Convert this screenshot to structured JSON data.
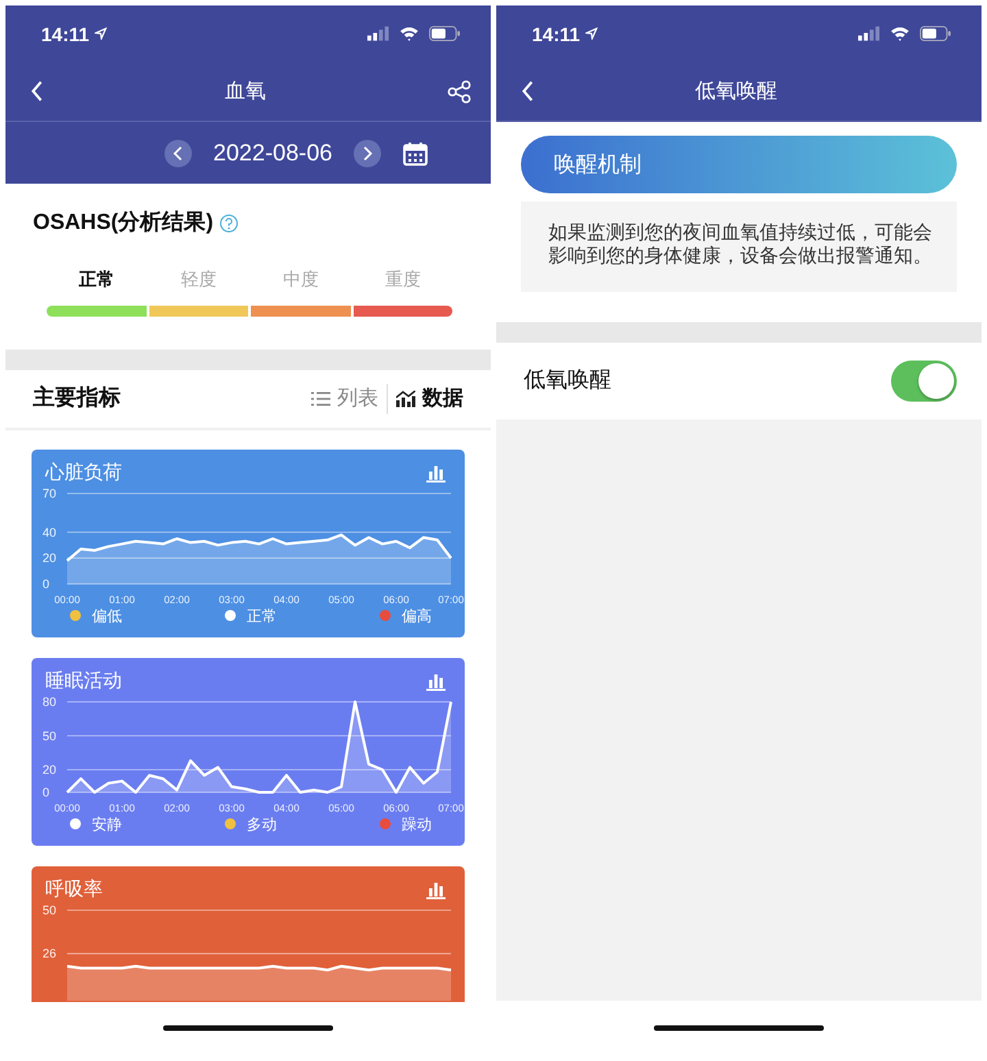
{
  "left_screen": {
    "status_bar": {
      "time": "14:11"
    },
    "nav_bar": {
      "title": "血氧"
    },
    "date_bar": {
      "date": "2022-08-06"
    },
    "osahs": {
      "title": "OSAHS(分析结果)",
      "levels": [
        {
          "label": "正常",
          "color": "#8ee05a",
          "selected": true
        },
        {
          "label": "轻度",
          "color": "#f0c85a",
          "selected": false
        },
        {
          "label": "中度",
          "color": "#ee9050",
          "selected": false
        },
        {
          "label": "重度",
          "color": "#e65a50",
          "selected": false
        }
      ]
    },
    "indicators": {
      "title": "主要指标",
      "tabs": [
        {
          "label": "列表",
          "selected": false
        },
        {
          "label": "数据",
          "selected": true
        }
      ]
    },
    "cards": [
      {
        "title": "心脏负荷",
        "color": "#4d8fe3",
        "chart_data": {
          "type": "area",
          "x": [
            "00:00",
            null,
            null,
            null,
            "01:00",
            null,
            null,
            null,
            "02:00",
            null,
            null,
            null,
            "03:00",
            null,
            null,
            null,
            "04:00",
            null,
            null,
            null,
            "05:00",
            null,
            null,
            null,
            "06:00",
            null,
            null,
            null,
            "07:00"
          ],
          "ylim": [
            0,
            70
          ],
          "yticks": [
            0,
            20,
            40,
            70
          ],
          "series": [
            {
              "color": "#ffffff",
              "values": [
                18,
                27,
                26,
                29,
                31,
                33,
                32,
                31,
                35,
                32,
                33,
                30,
                32,
                33,
                31,
                35,
                31,
                32,
                33,
                34,
                38,
                30,
                36,
                31,
                33,
                28,
                36,
                34,
                20
              ]
            }
          ]
        },
        "legend": [
          {
            "label": "偏低",
            "color": "#f0c040"
          },
          {
            "label": "正常",
            "color": "#ffffff"
          },
          {
            "label": "偏高",
            "color": "#e84c3c"
          }
        ]
      },
      {
        "title": "睡眠活动",
        "color": "#6a7df0",
        "chart_data": {
          "type": "area",
          "x": [
            "00:00",
            null,
            null,
            null,
            "01:00",
            null,
            null,
            null,
            "02:00",
            null,
            null,
            null,
            "03:00",
            null,
            null,
            null,
            "04:00",
            null,
            null,
            null,
            "05:00",
            null,
            null,
            null,
            "06:00",
            null,
            null,
            null,
            "07:00"
          ],
          "ylim": [
            0,
            80
          ],
          "yticks": [
            0,
            20,
            50,
            80
          ],
          "series": [
            {
              "color": "#ffffff",
              "values": [
                0,
                12,
                0,
                8,
                10,
                0,
                15,
                12,
                2,
                28,
                15,
                22,
                5,
                3,
                0,
                0,
                15,
                0,
                2,
                0,
                5,
                80,
                25,
                20,
                0,
                22,
                8,
                18,
                80
              ]
            }
          ]
        },
        "legend": [
          {
            "label": "安静",
            "color": "#ffffff"
          },
          {
            "label": "多动",
            "color": "#f0c040"
          },
          {
            "label": "躁动",
            "color": "#e84c3c"
          }
        ]
      },
      {
        "title": "呼吸率",
        "color": "#e0603a",
        "chart_data": {
          "type": "area",
          "ylim": [
            0,
            50
          ],
          "yticks": [
            26,
            50
          ],
          "series": [
            {
              "color": "#ffffff",
              "values": [
                19,
                18,
                18,
                18,
                18,
                19,
                18,
                18,
                18,
                18,
                18,
                18,
                18,
                18,
                18,
                19,
                18,
                18,
                18,
                17,
                19,
                18,
                17,
                18,
                18,
                18,
                18,
                18,
                17
              ]
            }
          ]
        }
      }
    ]
  },
  "right_screen": {
    "status_bar": {
      "time": "14:11"
    },
    "nav_bar": {
      "title": "低氧唤醒"
    },
    "mechanism": {
      "title": "唤醒机制",
      "text": "如果监测到您的夜间血氧值持续过低，可能会影响到您的身体健康，设备会做出报警通知。"
    },
    "setting": {
      "label": "低氧唤醒",
      "on": true
    }
  }
}
